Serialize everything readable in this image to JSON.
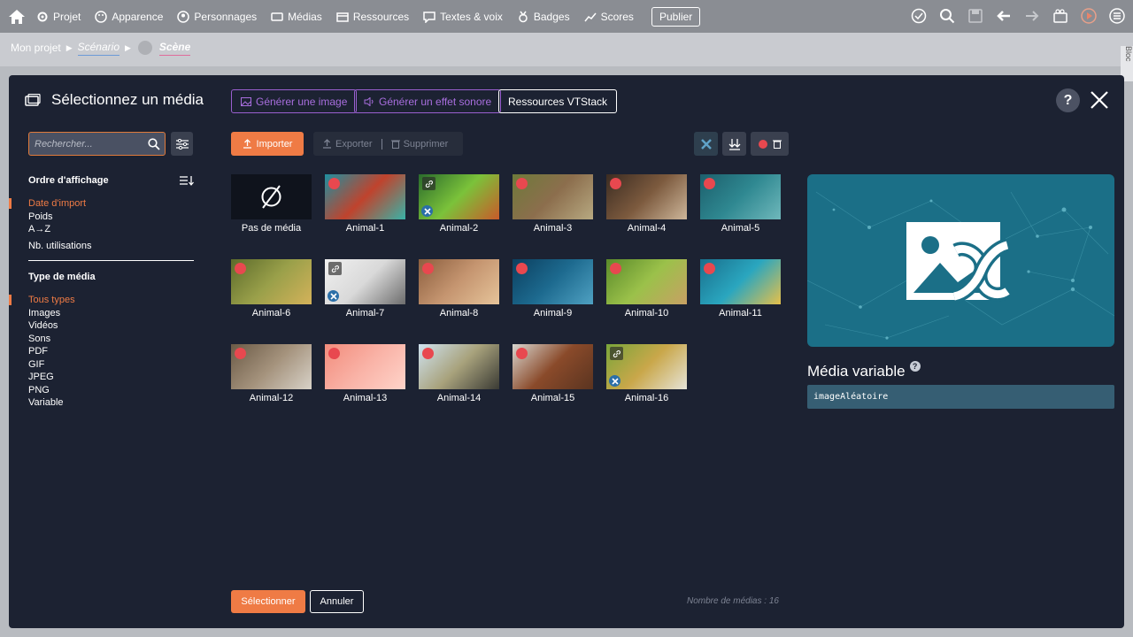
{
  "topbar": {
    "menu": [
      "Projet",
      "Apparence",
      "Personnages",
      "Médias",
      "Ressources",
      "Textes & voix",
      "Badges",
      "Scores"
    ],
    "publish": "Publier"
  },
  "breadcrumb": {
    "project": "Mon projet",
    "scenario": "Scénario",
    "scene": "Scène"
  },
  "right_tab": "Bloc",
  "modal": {
    "title": "Sélectionnez un média",
    "gen_image": "Générer une image",
    "gen_sound": "Générer un effet sonore",
    "vtstack": "Ressources VTStack",
    "help": "?"
  },
  "sidebar": {
    "search_placeholder": "Rechercher...",
    "order_heading": "Ordre d'affichage",
    "order_items": [
      "Date d'import",
      "Poids",
      "A→Z",
      "Nb. utilisations"
    ],
    "type_heading": "Type de média",
    "type_items": [
      "Tous types",
      "Images",
      "Vidéos",
      "Sons",
      "PDF",
      "GIF",
      "JPEG",
      "PNG",
      "Variable"
    ]
  },
  "toolbar": {
    "import": "Importer",
    "export": "Exporter",
    "delete": "Supprimer"
  },
  "media": [
    {
      "label": "Pas de média",
      "kind": "none"
    },
    {
      "label": "Animal-1",
      "kind": "dot",
      "colors": [
        "#1f8fa0",
        "#c0432d",
        "#39b3a8"
      ]
    },
    {
      "label": "Animal-2",
      "kind": "var",
      "colors": [
        "#2a6b2c",
        "#7bc23a",
        "#c95a2a"
      ]
    },
    {
      "label": "Animal-3",
      "kind": "dot",
      "colors": [
        "#6e7a3a",
        "#8c6e4d",
        "#b7a981"
      ]
    },
    {
      "label": "Animal-4",
      "kind": "dot",
      "colors": [
        "#3b2c22",
        "#7c5a3e",
        "#cdb69a"
      ]
    },
    {
      "label": "Animal-5",
      "kind": "dot",
      "colors": [
        "#1c5f6c",
        "#2f8891",
        "#6fb8bb"
      ]
    },
    {
      "label": "Animal-6",
      "kind": "dot",
      "colors": [
        "#5c6b2b",
        "#9aa04a",
        "#d4b25a"
      ]
    },
    {
      "label": "Animal-7",
      "kind": "var",
      "colors": [
        "#f0f0f0",
        "#d9d9d9",
        "#6d6d6d"
      ]
    },
    {
      "label": "Animal-8",
      "kind": "dot",
      "colors": [
        "#8b5e3e",
        "#c59570",
        "#e6c49a"
      ]
    },
    {
      "label": "Animal-9",
      "kind": "dot",
      "colors": [
        "#0b3f5f",
        "#1d6a8f",
        "#4fa1c2"
      ]
    },
    {
      "label": "Animal-10",
      "kind": "dot",
      "colors": [
        "#5a8a2a",
        "#9bc14a",
        "#c8a064"
      ]
    },
    {
      "label": "Animal-11",
      "kind": "dot",
      "colors": [
        "#196f8c",
        "#2aa6bf",
        "#e6c04a"
      ]
    },
    {
      "label": "Animal-12",
      "kind": "dot",
      "colors": [
        "#6b5a46",
        "#a4927c",
        "#d8d2c8"
      ]
    },
    {
      "label": "Animal-13",
      "kind": "dot",
      "colors": [
        "#f28c7c",
        "#f9b2a6",
        "#ffd4ca"
      ]
    },
    {
      "label": "Animal-14",
      "kind": "dot",
      "colors": [
        "#cfe2ef",
        "#a8a27c",
        "#3a3a34"
      ]
    },
    {
      "label": "Animal-15",
      "kind": "dot",
      "colors": [
        "#d8d6d0",
        "#8a4a2a",
        "#5a3420"
      ]
    },
    {
      "label": "Animal-16",
      "kind": "var",
      "colors": [
        "#7aa63a",
        "#c9a74a",
        "#e6e4d8"
      ]
    }
  ],
  "variable": {
    "title": "Média variable",
    "help": "?",
    "value": "imageAléatoire"
  },
  "footer": {
    "select": "Sélectionner",
    "cancel": "Annuler",
    "count": "Nombre de médias : 16"
  },
  "colors": {
    "accent": "#ef7b45",
    "purple": "#a86ede",
    "modal_bg": "#1c2232",
    "preview_bg": "#1b6f87",
    "delete_dot": "#e8484f"
  }
}
